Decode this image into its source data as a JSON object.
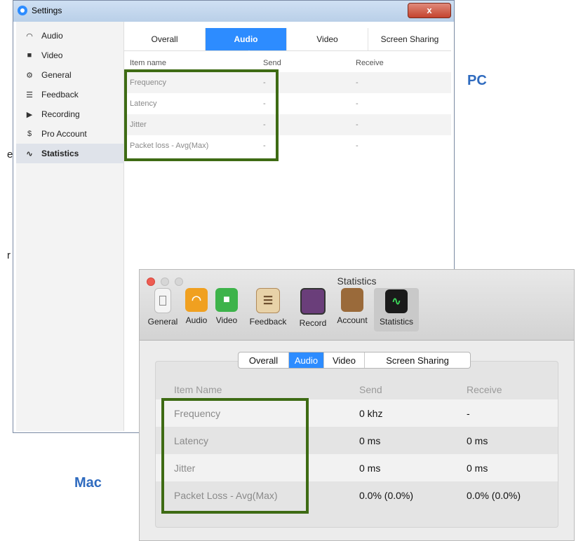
{
  "pc": {
    "window_title": "Settings",
    "close_label": "x",
    "sidebar": [
      {
        "label": "Audio",
        "icon": "headphones-icon",
        "glyph": "◠"
      },
      {
        "label": "Video",
        "icon": "camera-icon",
        "glyph": "■"
      },
      {
        "label": "General",
        "icon": "gear-icon",
        "glyph": "⚙"
      },
      {
        "label": "Feedback",
        "icon": "chat-icon",
        "glyph": "☰"
      },
      {
        "label": "Recording",
        "icon": "play-icon",
        "glyph": "▶"
      },
      {
        "label": "Pro Account",
        "icon": "dollar-icon",
        "glyph": "$"
      },
      {
        "label": "Statistics",
        "icon": "pulse-icon",
        "glyph": "∿"
      }
    ],
    "active_sidebar": "Statistics",
    "tabs": [
      "Overall",
      "Audio",
      "Video",
      "Screen Sharing"
    ],
    "active_tab": "Audio",
    "table": {
      "headers": [
        "Item name",
        "Send",
        "Receive"
      ],
      "rows": [
        [
          "Frequency",
          "-",
          "-"
        ],
        [
          "Latency",
          "-",
          "-"
        ],
        [
          "Jitter",
          "-",
          "-"
        ],
        [
          "Packet loss - Avg(Max)",
          "-",
          "-"
        ]
      ]
    },
    "caption": "PC"
  },
  "mac": {
    "window_title": "Statistics",
    "toolbar": [
      {
        "label": "General",
        "icon": "general-icon",
        "color": "#ffffff"
      },
      {
        "label": "Audio",
        "icon": "headphones-icon",
        "color": "#f0a020"
      },
      {
        "label": "Video",
        "icon": "camera-icon",
        "color": "#3db34a"
      },
      {
        "label": "Feedback",
        "icon": "clipboard-icon",
        "color": "#c8a070"
      },
      {
        "label": "Record",
        "icon": "film-icon",
        "color": "#7a4a8a"
      },
      {
        "label": "Account",
        "icon": "wallet-icon",
        "color": "#9a6a3a"
      },
      {
        "label": "Statistics",
        "icon": "activity-monitor-icon",
        "color": "#1a1a1a"
      }
    ],
    "active_tool": "Statistics",
    "tabs": [
      "Overall",
      "Audio",
      "Video",
      "Screen Sharing"
    ],
    "active_tab": "Audio",
    "table": {
      "headers": [
        "Item Name",
        "Send",
        "Receive"
      ],
      "rows": [
        [
          "Frequency",
          "0 khz",
          "-"
        ],
        [
          "Latency",
          "0 ms",
          "0 ms"
        ],
        [
          "Jitter",
          "0 ms",
          "0 ms"
        ],
        [
          "Packet Loss - Avg(Max)",
          "0.0% (0.0%)",
          "0.0% (0.0%)"
        ]
      ]
    },
    "caption": "Mac"
  },
  "fragments": [
    "e",
    "r"
  ],
  "colors": {
    "accent": "#2d8cff",
    "highlight": "#3e6b14",
    "caption": "#2f6bbf"
  }
}
